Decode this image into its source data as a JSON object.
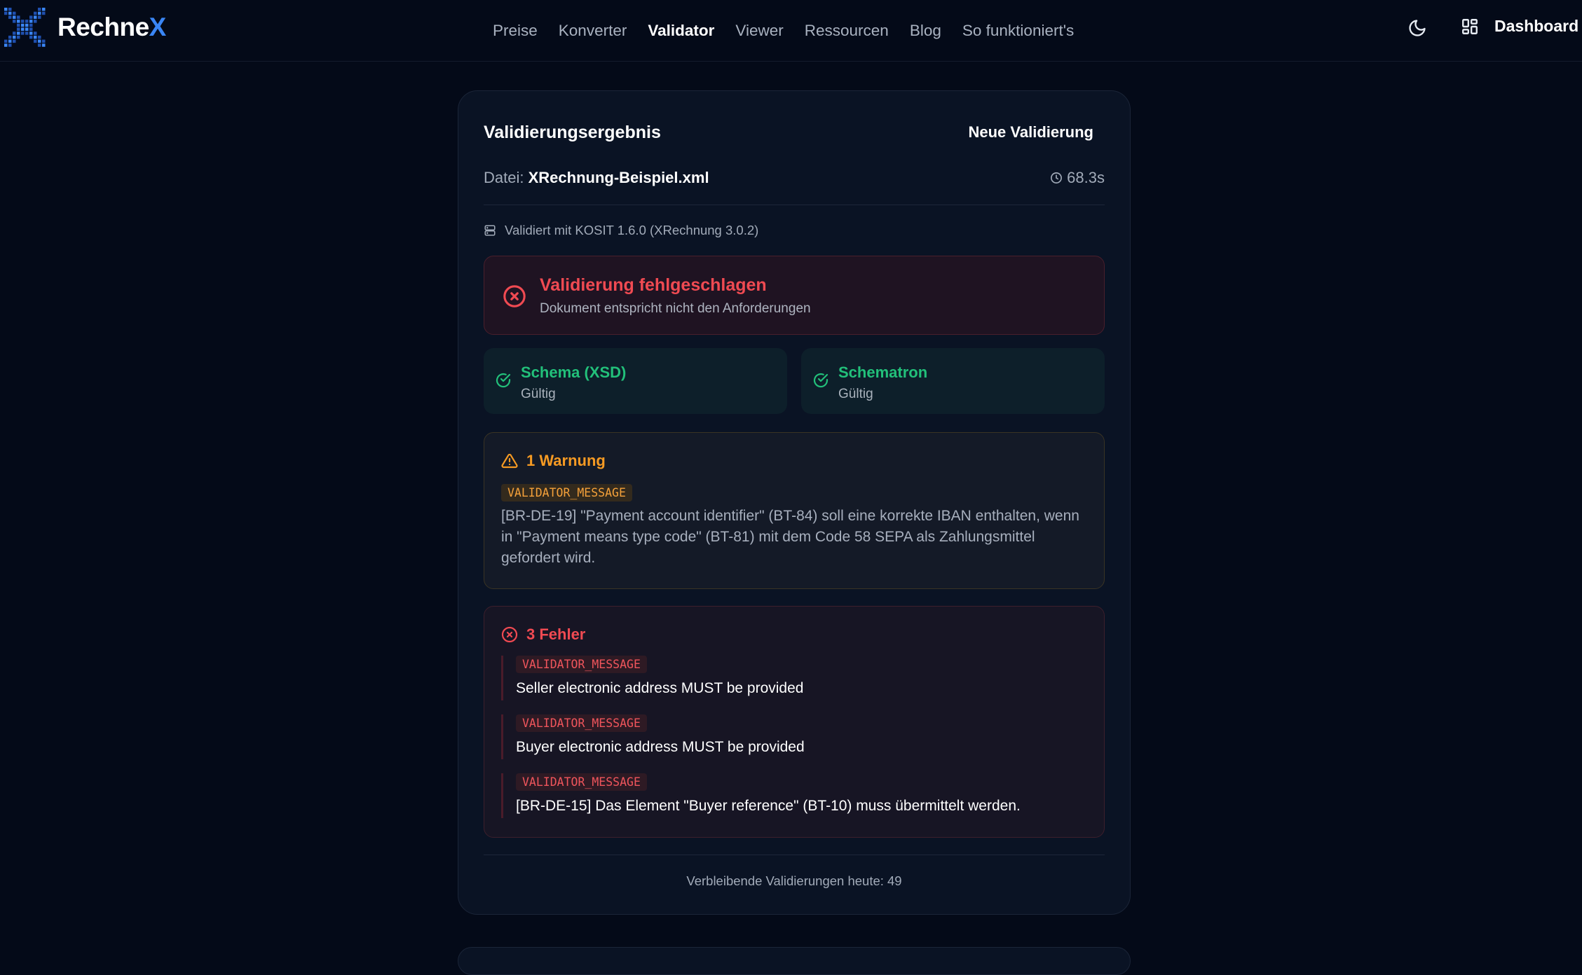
{
  "nav": {
    "brand_prefix": "Rechne",
    "brand_suffix": "X",
    "links": [
      {
        "label": "Preise",
        "active": false
      },
      {
        "label": "Konverter",
        "active": false
      },
      {
        "label": "Validator",
        "active": true
      },
      {
        "label": "Viewer",
        "active": false
      },
      {
        "label": "Ressourcen",
        "active": false
      },
      {
        "label": "Blog",
        "active": false
      },
      {
        "label": "So funktioniert's",
        "active": false
      }
    ],
    "theme_icon": "moon-icon",
    "dashboard_icon": "grid-icon",
    "dashboard_label": "Dashboard"
  },
  "result": {
    "title": "Validierungsergebnis",
    "new_button": "Neue Validierung",
    "file_label": "Datei:",
    "file_name": "XRechnung-Beispiel.xml",
    "duration": "68.3s",
    "validator_info": "Validiert mit KOSIT 1.6.0 (XRechnung 3.0.2)",
    "status": {
      "title": "Validierung fehlgeschlagen",
      "subtitle": "Dokument entspricht nicht den Anforderungen"
    },
    "checks": [
      {
        "name": "Schema (XSD)",
        "status": "Gültig"
      },
      {
        "name": "Schematron",
        "status": "Gültig"
      }
    ],
    "warnings": {
      "heading": "1 Warnung",
      "items": [
        {
          "tag": "VALIDATOR_MESSAGE",
          "message": "[BR-DE-19] \"Payment account identifier\" (BT-84) soll eine korrekte IBAN enthalten, wenn in \"Payment means type code\" (BT-81) mit dem Code 58 SEPA als Zahlungsmittel gefordert wird."
        }
      ]
    },
    "errors": {
      "heading": "3 Fehler",
      "items": [
        {
          "tag": "VALIDATOR_MESSAGE",
          "message": "Seller electronic address MUST be provided"
        },
        {
          "tag": "VALIDATOR_MESSAGE",
          "message": "Buyer electronic address MUST be provided"
        },
        {
          "tag": "VALIDATOR_MESSAGE",
          "message": "[BR-DE-15] Das Element \"Buyer reference\" (BT-10) muss übermittelt werden."
        }
      ]
    },
    "remaining": "Verbleibende Validierungen heute: 49"
  },
  "colors": {
    "accent": "#3a86f5",
    "error": "#f04a52",
    "warning": "#f59a23",
    "success": "#22c07a",
    "background": "#040a18"
  }
}
